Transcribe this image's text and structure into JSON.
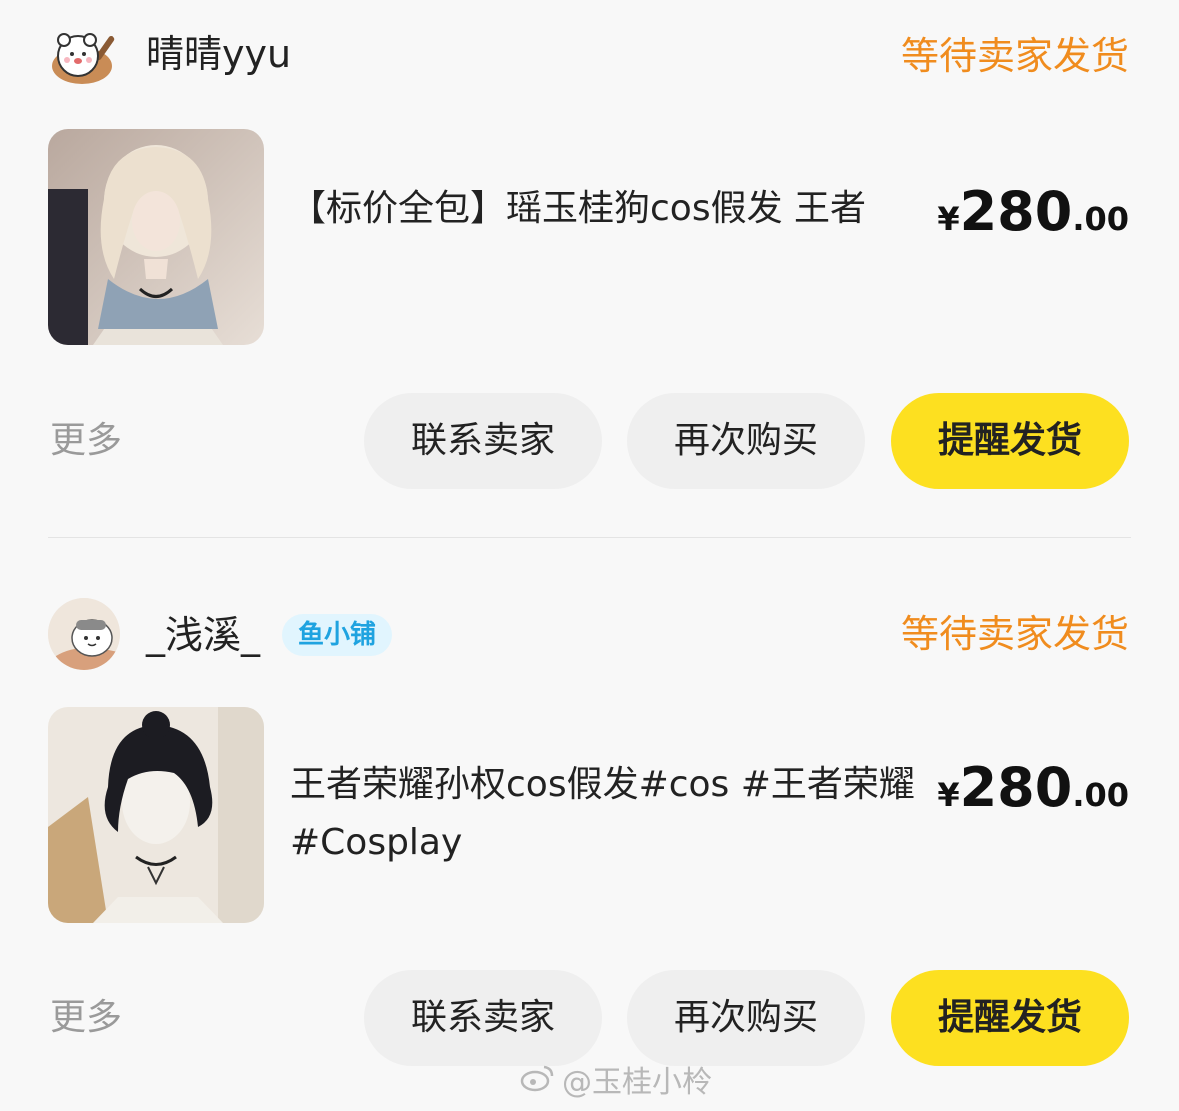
{
  "orders": [
    {
      "seller_name": "晴晴yyu",
      "status": "等待卖家发货",
      "product_title": "【标价全包】瑶玉桂狗cos假发 王者",
      "price_currency": "¥",
      "price_integer": "280",
      "price_decimal": ".00",
      "more_label": "更多",
      "buttons": {
        "contact": "联系卖家",
        "rebuy": "再次购买",
        "remind": "提醒发货"
      }
    },
    {
      "seller_name": "_浅溪_",
      "shop_badge": "鱼小铺",
      "status": "等待卖家发货",
      "product_title": "王者荣耀孙权cos假发#cos #王者荣耀 #Cosplay",
      "price_currency": "¥",
      "price_integer": "280",
      "price_decimal": ".00",
      "more_label": "更多",
      "buttons": {
        "contact": "联系卖家",
        "rebuy": "再次购买",
        "remind": "提醒发货"
      }
    }
  ],
  "watermark": "@玉桂小柃",
  "colors": {
    "status": "#f08c1e",
    "remind_button": "#fde020",
    "badge_bg": "#e1f5fe",
    "badge_text": "#1fa3e0"
  },
  "icons": {
    "avatar1": "bear-avatar",
    "avatar2": "bird-avatar",
    "watermark_logo": "weibo-icon"
  }
}
